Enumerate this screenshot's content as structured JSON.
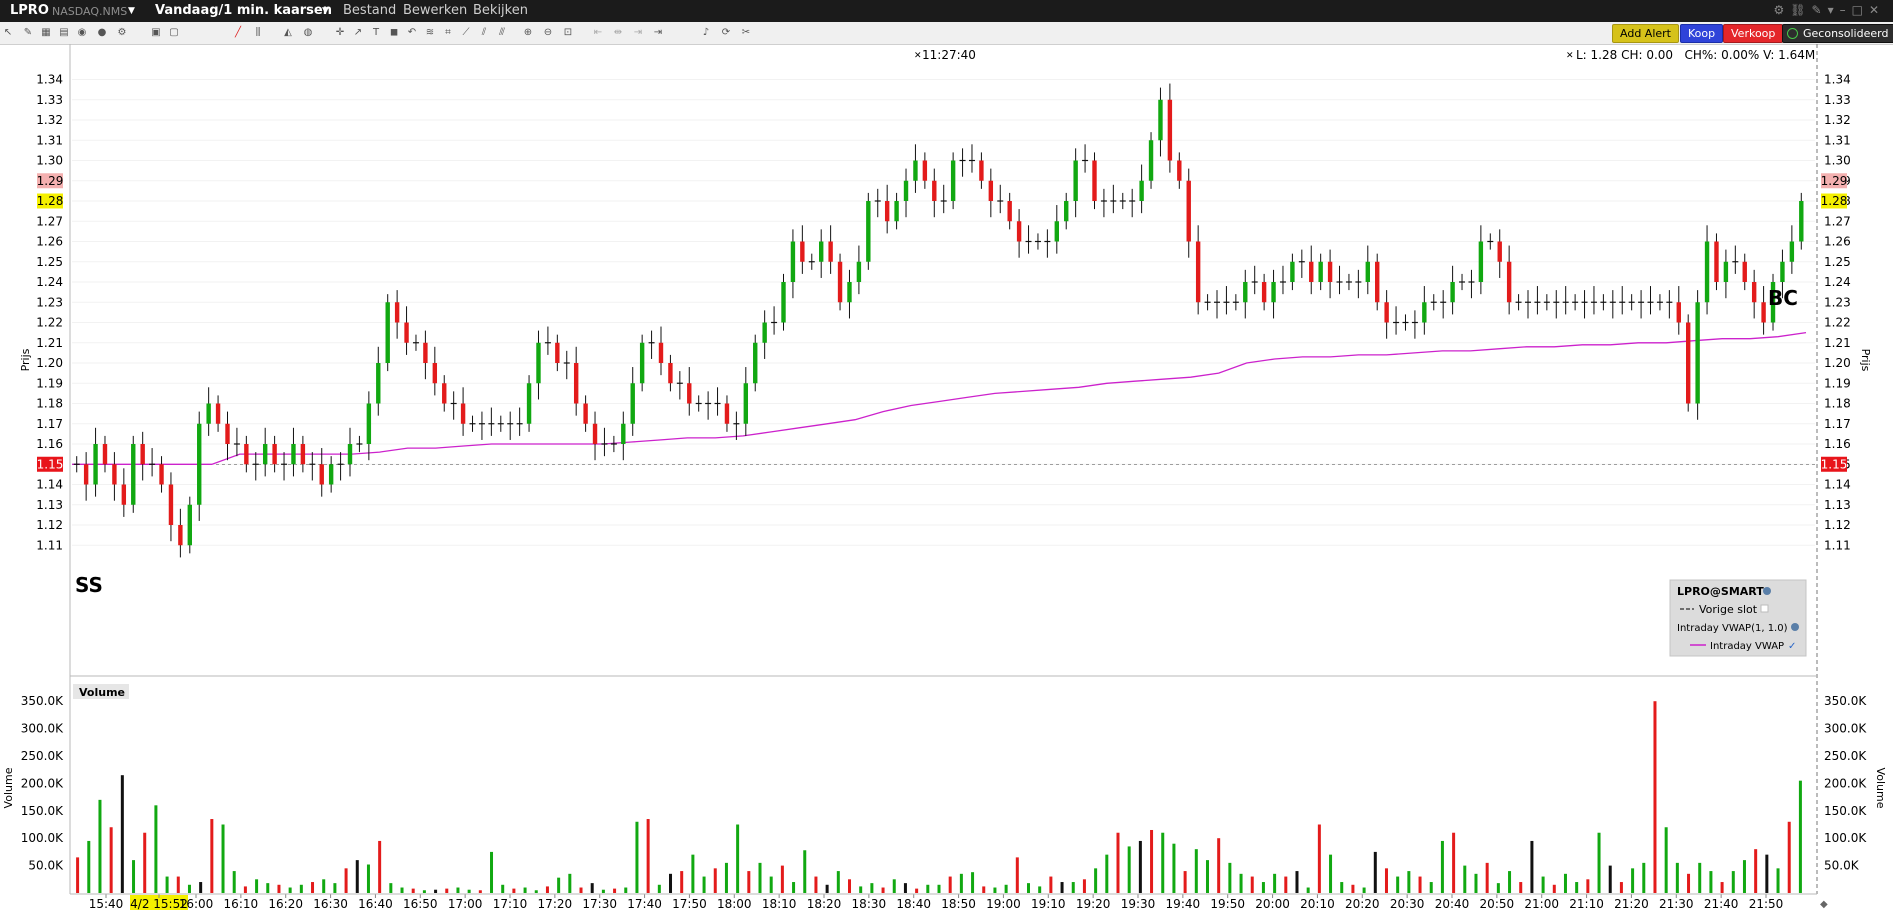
{
  "header": {
    "symbol": "LPRO",
    "exchange": "NASDAQ.NMS",
    "period": "Vandaag/1 min. kaarsen",
    "menu": [
      "Bestand",
      "Bewerken",
      "Bekijken"
    ],
    "buttons": {
      "alert": "Add Alert",
      "buy": "Koop",
      "sell": "Verkoop",
      "consolidated": "Geconsolideerd"
    },
    "colors": {
      "alert": "#d6c21a",
      "buy": "#2f43d9",
      "sell": "#e4262a",
      "consolidated": "#2d2d2d"
    }
  },
  "crosshair_time": "11:27:40",
  "quote_readout": "L: 1.28 CH: 0.00   CH%: 0.00% V: 1.64M",
  "price_axis_title": "Prijs",
  "volume_axis_title": "Volume",
  "volume_panel_label": "Volume",
  "legend": {
    "title": "LPRO@SMART",
    "prev_close": "Vorige slot",
    "vwap_study": "Intraday VWAP(1, 1.0)",
    "vwap_line": "Intraday VWAP"
  },
  "annotations": [
    "SS",
    "BC"
  ],
  "markers": {
    "last_price": "1.28",
    "high_marker": "1.29",
    "prev_close": "1.15",
    "time_highlight": "4/2 15:52"
  },
  "chart_data": [
    {
      "type": "candlestick",
      "title": "",
      "ylabel": "Prijs",
      "ylim": [
        1.1,
        1.345
      ],
      "price_ticks": [
        "1.11",
        "1.12",
        "1.13",
        "1.14",
        "1.15",
        "1.16",
        "1.17",
        "1.18",
        "1.19",
        "1.20",
        "1.21",
        "1.22",
        "1.23",
        "1.24",
        "1.25",
        "1.26",
        "1.27",
        "1.28",
        "1.29",
        "1.30",
        "1.31",
        "1.32",
        "1.33",
        "1.34"
      ],
      "x_ticks": [
        "15:40",
        "4/2 15:52",
        "16:00",
        "16:10",
        "16:20",
        "16:30",
        "16:40",
        "16:50",
        "17:00",
        "17:10",
        "17:20",
        "17:30",
        "17:40",
        "17:50",
        "18:00",
        "18:10",
        "18:20",
        "18:30",
        "18:40",
        "18:50",
        "19:00",
        "19:10",
        "19:20",
        "19:30",
        "19:40",
        "19:50",
        "20:00",
        "20:10",
        "20:20",
        "20:30",
        "20:40",
        "20:50",
        "21:00",
        "21:10",
        "21:20",
        "21:30",
        "21:40",
        "21:50"
      ],
      "colors": {
        "up": "#11a811",
        "down": "#e31b1b",
        "flat": "#111111",
        "vwap": "#cc22cc",
        "prev_close": "#444444"
      },
      "candles_close": [
        1.15,
        1.14,
        1.16,
        1.15,
        1.14,
        1.13,
        1.16,
        1.15,
        1.15,
        1.14,
        1.12,
        1.11,
        1.13,
        1.17,
        1.18,
        1.17,
        1.16,
        1.16,
        1.15,
        1.15,
        1.16,
        1.15,
        1.15,
        1.16,
        1.15,
        1.15,
        1.14,
        1.15,
        1.15,
        1.16,
        1.16,
        1.18,
        1.2,
        1.23,
        1.22,
        1.21,
        1.21,
        1.2,
        1.19,
        1.18,
        1.18,
        1.17,
        1.17,
        1.17,
        1.17,
        1.17,
        1.17,
        1.17,
        1.19,
        1.21,
        1.21,
        1.2,
        1.2,
        1.18,
        1.17,
        1.16,
        1.16,
        1.16,
        1.17,
        1.19,
        1.21,
        1.21,
        1.2,
        1.19,
        1.19,
        1.18,
        1.18,
        1.18,
        1.18,
        1.17,
        1.17,
        1.19,
        1.21,
        1.22,
        1.22,
        1.24,
        1.26,
        1.25,
        1.25,
        1.26,
        1.25,
        1.23,
        1.24,
        1.25,
        1.28,
        1.28,
        1.27,
        1.28,
        1.29,
        1.3,
        1.29,
        1.28,
        1.28,
        1.3,
        1.3,
        1.3,
        1.29,
        1.28,
        1.28,
        1.27,
        1.26,
        1.26,
        1.26,
        1.26,
        1.27,
        1.28,
        1.3,
        1.3,
        1.28,
        1.28,
        1.28,
        1.28,
        1.28,
        1.29,
        1.31,
        1.33,
        1.3,
        1.29,
        1.26,
        1.23,
        1.23,
        1.23,
        1.23,
        1.23,
        1.24,
        1.24,
        1.23,
        1.24,
        1.24,
        1.25,
        1.25,
        1.24,
        1.25,
        1.24,
        1.24,
        1.24,
        1.24,
        1.25,
        1.23,
        1.22,
        1.22,
        1.22,
        1.22,
        1.23,
        1.23,
        1.23,
        1.24,
        1.24,
        1.24,
        1.26,
        1.26,
        1.25,
        1.23,
        1.23,
        1.23,
        1.23,
        1.23,
        1.23,
        1.23,
        1.23,
        1.23,
        1.23,
        1.23,
        1.23,
        1.23,
        1.23,
        1.23,
        1.23,
        1.23,
        1.23,
        1.22,
        1.18,
        1.23,
        1.26,
        1.24,
        1.25,
        1.25,
        1.24,
        1.23,
        1.22,
        1.24,
        1.25,
        1.26,
        1.28
      ],
      "vwap": [
        1.15,
        1.15,
        1.15,
        1.15,
        1.15,
        1.15,
        1.155,
        1.155,
        1.155,
        1.155,
        1.155,
        1.156,
        1.158,
        1.158,
        1.159,
        1.16,
        1.16,
        1.16,
        1.16,
        1.16,
        1.161,
        1.162,
        1.163,
        1.163,
        1.164,
        1.166,
        1.168,
        1.17,
        1.172,
        1.176,
        1.179,
        1.181,
        1.183,
        1.185,
        1.186,
        1.187,
        1.188,
        1.19,
        1.191,
        1.192,
        1.193,
        1.195,
        1.2,
        1.202,
        1.203,
        1.203,
        1.204,
        1.204,
        1.205,
        1.206,
        1.206,
        1.207,
        1.208,
        1.208,
        1.209,
        1.209,
        1.21,
        1.21,
        1.211,
        1.212,
        1.212,
        1.213,
        1.215
      ]
    },
    {
      "type": "bar",
      "title": "Volume",
      "ylabel": "Volume",
      "ylim": [
        0,
        365000
      ],
      "y_ticks": [
        "50.0K",
        "100.0K",
        "150.0K",
        "200.0K",
        "250.0K",
        "300.0K",
        "350.0K"
      ],
      "values": [
        65000,
        95000,
        170000,
        120000,
        215000,
        60000,
        110000,
        160000,
        30000,
        30000,
        15000,
        20000,
        135000,
        125000,
        40000,
        12000,
        25000,
        18000,
        15000,
        10000,
        15000,
        20000,
        25000,
        18000,
        45000,
        60000,
        52000,
        95000,
        18000,
        10000,
        8000,
        5000,
        6000,
        8000,
        10000,
        6000,
        5000,
        75000,
        15000,
        8000,
        10000,
        5000,
        12000,
        28000,
        35000,
        10000,
        18000,
        6000,
        8000,
        10000,
        130000,
        135000,
        15000,
        35000,
        40000,
        70000,
        30000,
        45000,
        55000,
        125000,
        40000,
        55000,
        30000,
        50000,
        20000,
        78000,
        30000,
        15000,
        40000,
        25000,
        12000,
        18000,
        10000,
        25000,
        18000,
        8000,
        15000,
        15000,
        30000,
        35000,
        38000,
        12000,
        10000,
        15000,
        65000,
        18000,
        12000,
        30000,
        20000,
        20000,
        25000,
        45000,
        70000,
        110000,
        85000,
        95000,
        115000,
        110000,
        90000,
        40000,
        80000,
        60000,
        100000,
        55000,
        35000,
        30000,
        20000,
        35000,
        30000,
        40000,
        10000,
        125000,
        70000,
        20000,
        15000,
        10000,
        75000,
        45000,
        30000,
        40000,
        30000,
        20000,
        95000,
        110000,
        50000,
        35000,
        55000,
        18000,
        40000,
        20000,
        95000,
        30000,
        15000,
        35000,
        20000,
        25000,
        110000,
        50000,
        20000,
        45000,
        55000,
        350000,
        120000,
        55000,
        35000,
        55000,
        40000,
        20000,
        40000,
        60000,
        80000,
        70000,
        45000,
        130000,
        205000
      ]
    }
  ]
}
